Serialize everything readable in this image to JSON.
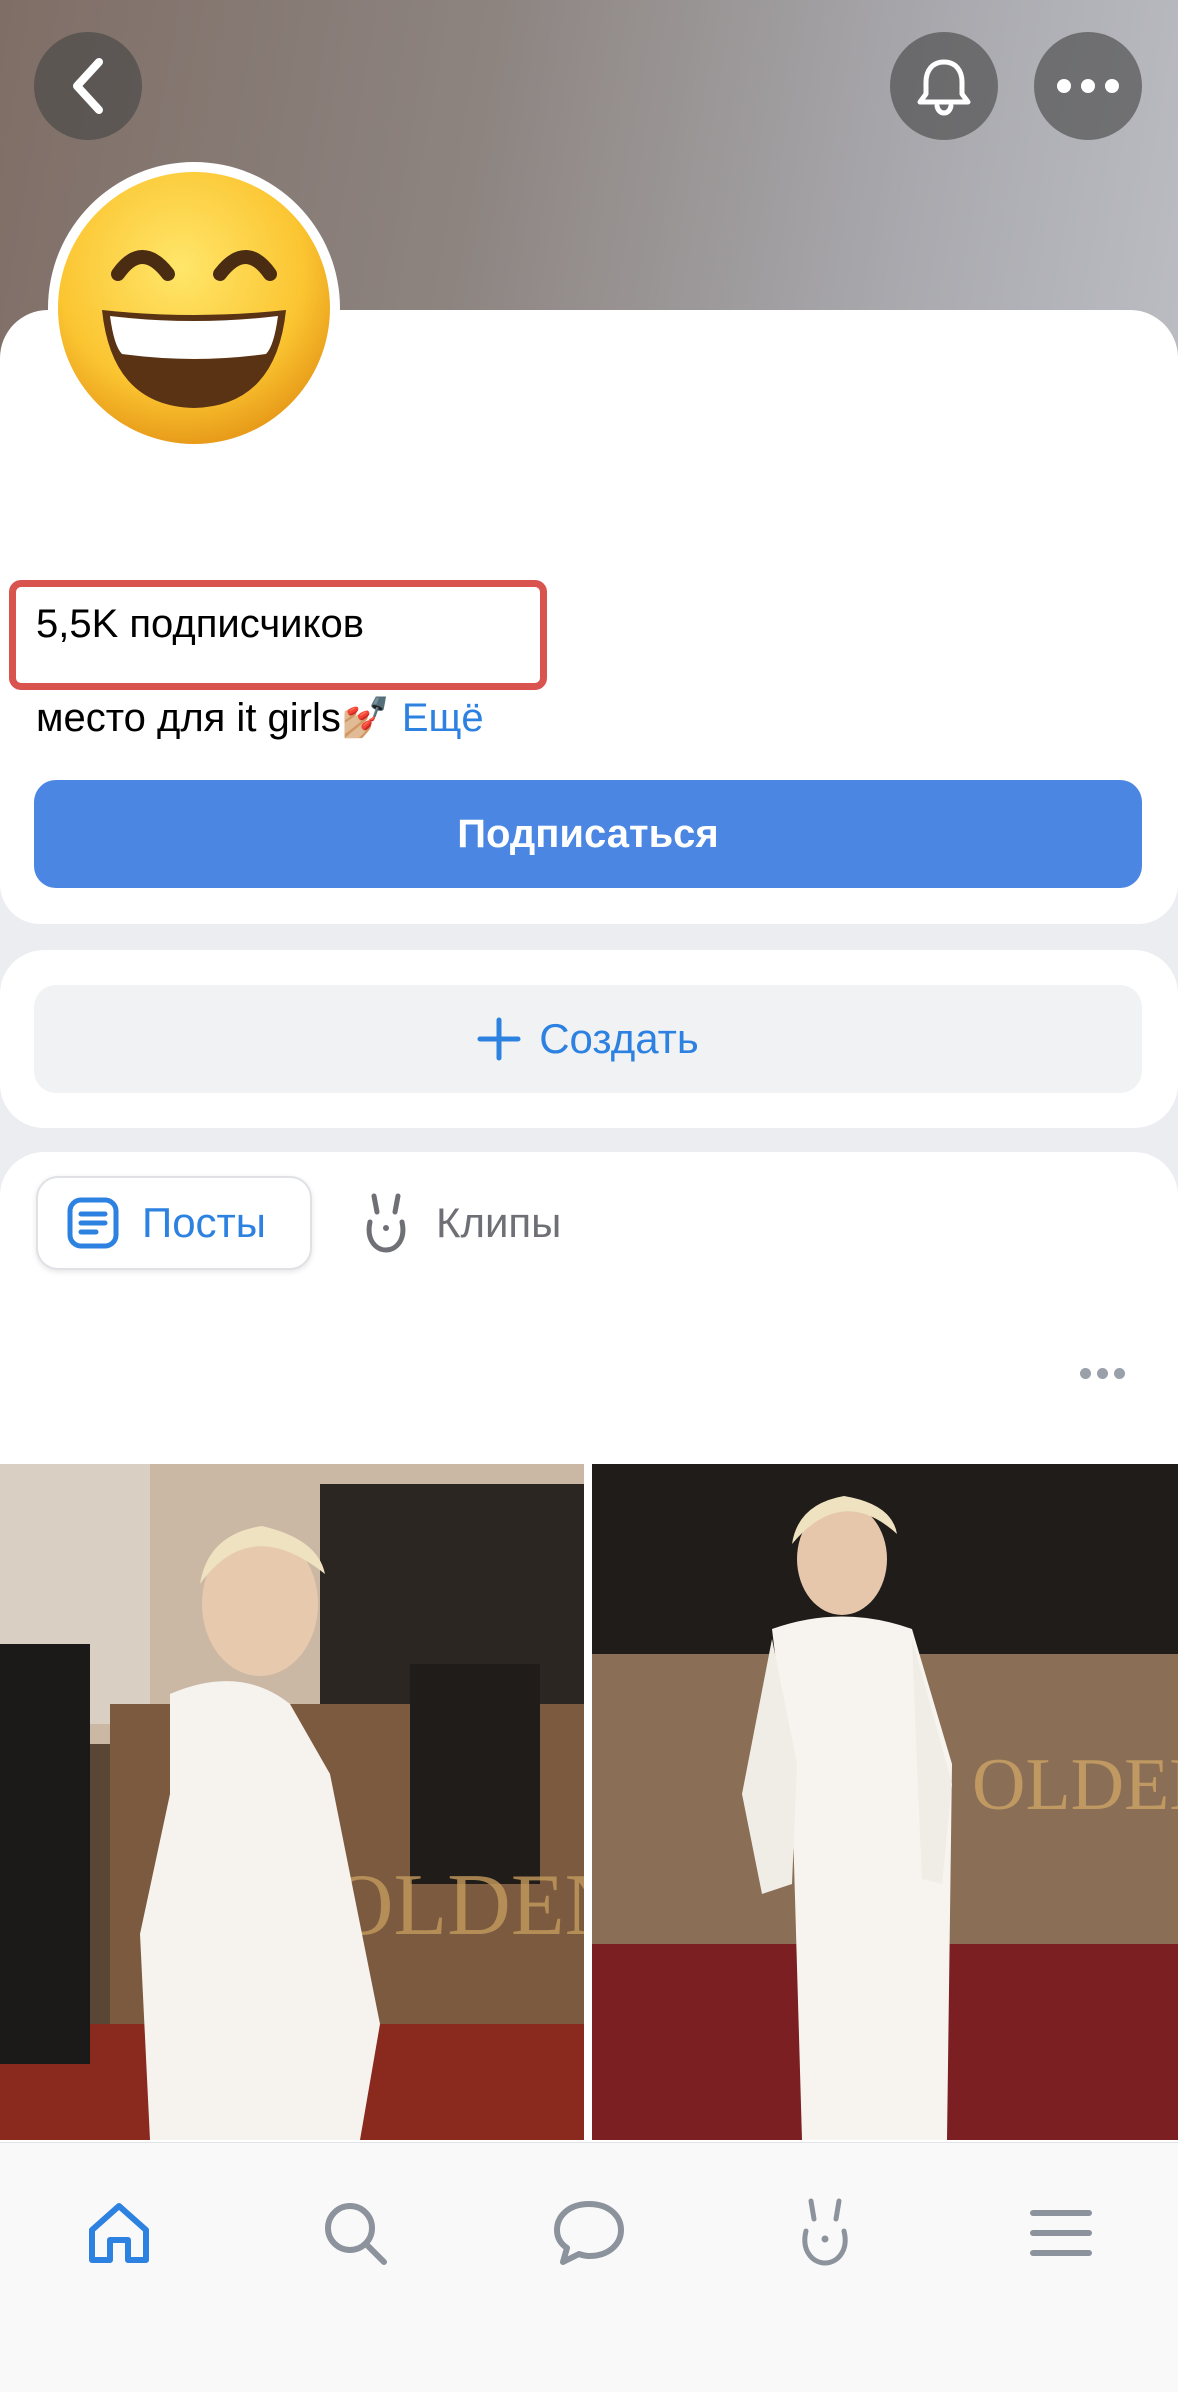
{
  "profile": {
    "followers": "5,5K подписчиков",
    "status_text": "место для it girls",
    "status_emoji": "💅🏼",
    "more_link": "Ещё",
    "subscribe_label": "Подписаться",
    "avatar_emoji": "😄"
  },
  "create": {
    "label": "Создать"
  },
  "tabs": [
    {
      "label": "Посты",
      "active": true
    },
    {
      "label": "Клипы",
      "active": false
    }
  ],
  "bottom_nav": [
    "home-icon",
    "search-icon",
    "messages-icon",
    "clips-icon",
    "menu-icon"
  ],
  "colors": {
    "accent": "#4a86e2",
    "link": "#2d81e0",
    "highlight": "#d9534f"
  }
}
